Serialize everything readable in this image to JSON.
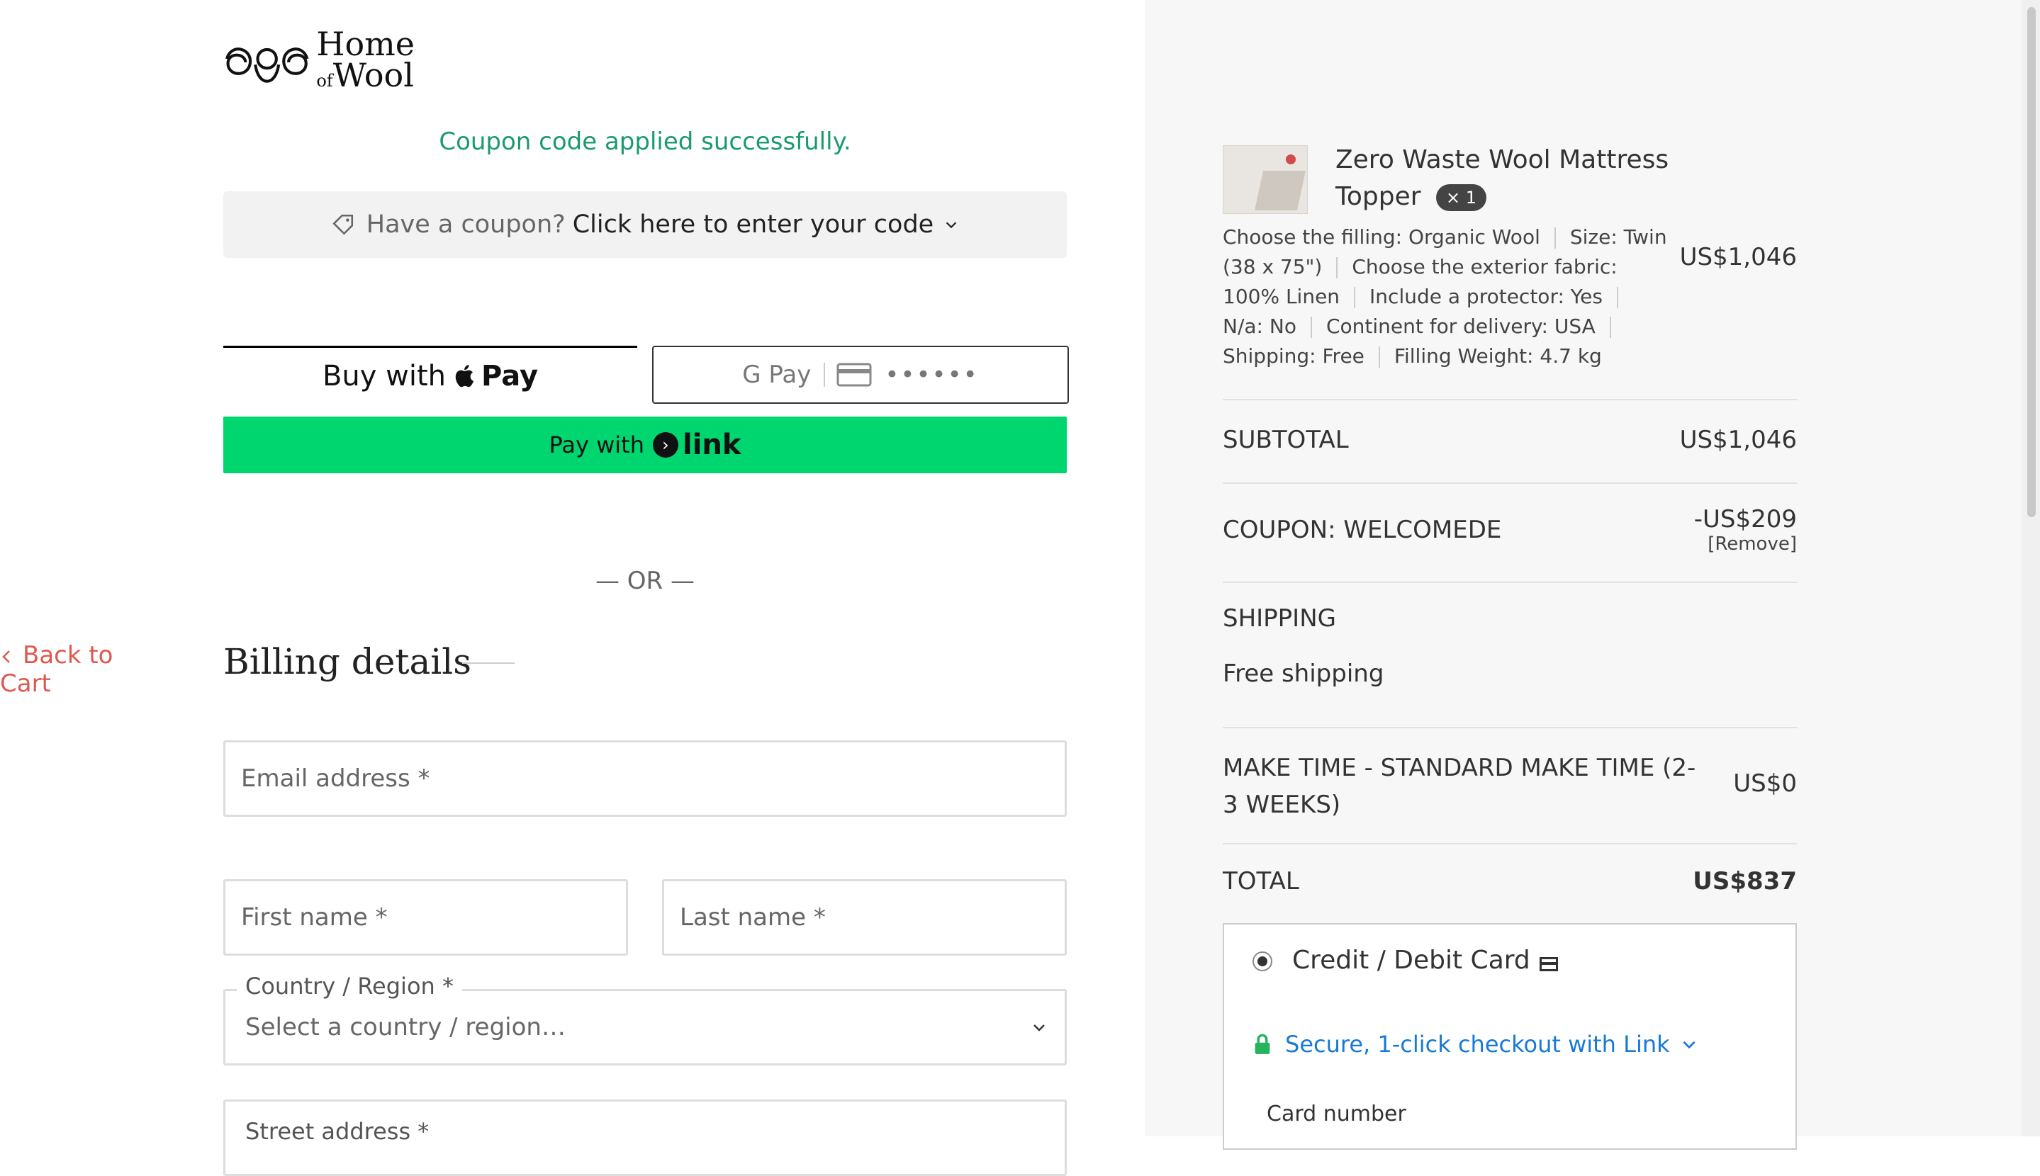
{
  "brand": {
    "logo_line1": "Home",
    "logo_of": "of",
    "logo_line2": "Wool"
  },
  "coupon": {
    "success_message": "Coupon code applied successfully.",
    "prompt": "Have a coupon?",
    "link": "Click here to enter your code"
  },
  "express": {
    "apple_pay_prefix": "Buy with",
    "apple_pay_brand": "Pay",
    "google_pay": "G Pay",
    "card_dots": "••••••",
    "link_prefix": "Pay with",
    "link_brand": "link"
  },
  "separator": "— OR —",
  "billing": {
    "title": "Billing details",
    "back_to_cart": "Back to Cart",
    "email_placeholder": "Email address *",
    "first_name_placeholder": "First name *",
    "last_name_placeholder": "Last name *",
    "country_label": "Country / Region *",
    "country_placeholder": "Select a country / region…",
    "street_label": "Street address *"
  },
  "order": {
    "product_name": "Zero Waste Wool Mattress Topper",
    "quantity": "× 1",
    "meta": [
      "Choose the filling: Organic Wool",
      "Size: Twin (38 x 75\")",
      "Choose the exterior fabric: 100% Linen",
      "Include a protector: Yes",
      "N/a: No",
      "Continent for delivery: USA",
      "Shipping: Free",
      "Filling Weight: 4.7 kg"
    ],
    "product_price": "US$1,046",
    "subtotal_label": "SUBTOTAL",
    "subtotal_value": "US$1,046",
    "coupon_label": "COUPON: WELCOMEDE",
    "coupon_value": "-US$209",
    "coupon_remove": "[Remove]",
    "shipping_label": "SHIPPING",
    "shipping_value": "Free shipping",
    "maketime_label": "MAKE TIME - STANDARD MAKE TIME (2-3 WEEKS)",
    "maketime_value": "US$0",
    "total_label": "TOTAL",
    "total_value": "US$837"
  },
  "payment": {
    "method_label": "Credit / Debit Card",
    "secure_link": "Secure, 1-click checkout with Link",
    "card_number_label": "Card number"
  }
}
